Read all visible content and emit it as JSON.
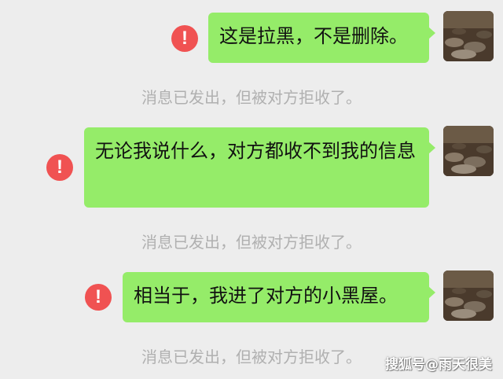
{
  "messages": [
    {
      "text": "这是拉黑，不是删除。",
      "status_icon": "exclamation-icon",
      "status_glyph": "!",
      "notice": "消息已发出，但被对方拒收了。"
    },
    {
      "text": "无论我说什么，对方都收不到我的信息",
      "status_icon": "exclamation-icon",
      "status_glyph": "!",
      "notice": "消息已发出，但被对方拒收了。"
    },
    {
      "text": "相当于，我进了对方的小黑屋。",
      "status_icon": "exclamation-icon",
      "status_glyph": "!",
      "notice": "消息已发出，但被对方拒收了。"
    }
  ],
  "watermark": "搜狐号@雨天很美",
  "colors": {
    "background": "#ededed",
    "bubble": "#95ec69",
    "error": "#f05252",
    "notice_text": "#b0b0b0"
  }
}
